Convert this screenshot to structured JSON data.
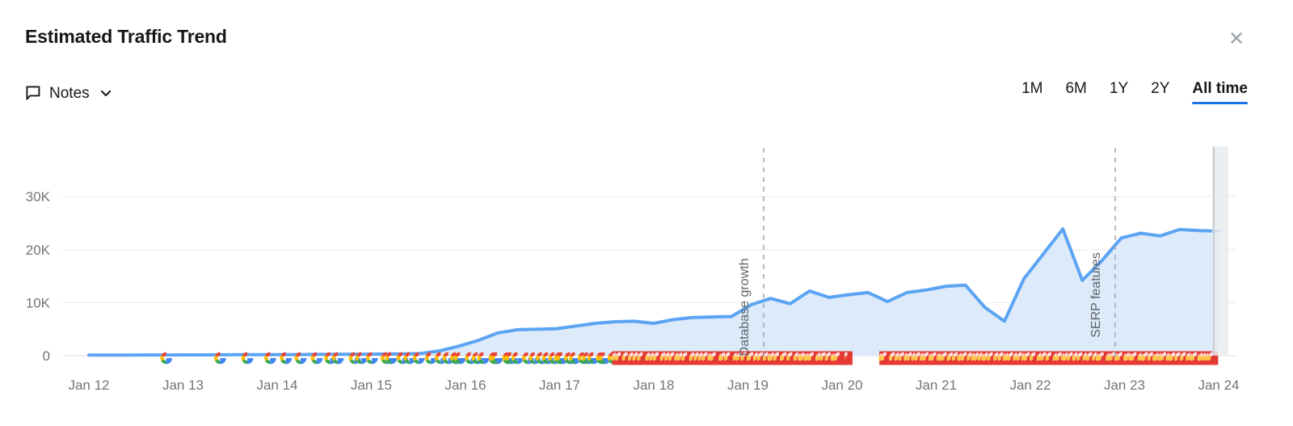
{
  "header": {
    "title": "Estimated Traffic Trend",
    "close_icon": "close-icon",
    "close_label": "×"
  },
  "notes": {
    "label": "Notes",
    "icon": "comment-bubble-icon",
    "caret_icon": "chevron-down-icon",
    "expanded": false
  },
  "range_selector": {
    "options": [
      {
        "label": "1M",
        "active": false
      },
      {
        "label": "6M",
        "active": false
      },
      {
        "label": "1Y",
        "active": false
      },
      {
        "label": "2Y",
        "active": false
      },
      {
        "label": "All time",
        "active": true
      }
    ],
    "selected": "All time",
    "accent_color": "#1a73e8"
  },
  "colors": {
    "line": "#5ba4f3",
    "fill": "#dceafa",
    "grid": "#e8eaed",
    "axis_text": "#70757a",
    "annotation_text": "#5f6368",
    "dashed_line": "#9aa0a6",
    "cursor_band": "#e9ecef",
    "title_text": "#15181b"
  },
  "chart_data": {
    "type": "area",
    "title": "Estimated Traffic Trend",
    "xlabel": "",
    "ylabel": "",
    "grid": true,
    "legend": "none",
    "ylim": [
      0,
      34000
    ],
    "ytick_values": [
      0,
      10000,
      20000,
      30000
    ],
    "ytick_labels": [
      "0",
      "10K",
      "20K",
      "30K"
    ],
    "xtick_labels": [
      "Jan 12",
      "Jan 13",
      "Jan 14",
      "Jan 15",
      "Jan 16",
      "Jan 17",
      "Jan 18",
      "Jan 19",
      "Jan 20",
      "Jan 21",
      "Jan 22",
      "Jan 23",
      "Jan 24"
    ],
    "x": [
      "Jan 12",
      "Jan 12.5",
      "Jan 13",
      "Jan 13.5",
      "Jan 14",
      "Jan 14.5",
      "Jan 15",
      "Jan 15.5",
      "Jan 16",
      "Jan 16.5",
      "Jan 17",
      "Jan 17.5",
      "Jan 18",
      "Jan 18.5",
      "Jan 19",
      "Jan 19.5",
      "Jan 20",
      "Jan 20.3",
      "Jan 20.6",
      "Jan 20.8",
      "Jan 21",
      "Jan 21.1",
      "Jan 21.2",
      "Jan 21.3",
      "Jan 21.4",
      "Jan 21.5",
      "Jan 21.6",
      "Jan 21.7",
      "Jan 21.8",
      "Jan 21.9",
      "Jan 22",
      "Jan 22.1",
      "Jan 22.2",
      "Jan 22.3",
      "Jan 22.4",
      "Jan 22.5",
      "Jan 22.6",
      "Jan 22.7",
      "Jan 22.8",
      "Jan 22.9",
      "Jan 23",
      "Jan 23.1",
      "Jan 23.2",
      "Jan 23.3",
      "Jan 23.4",
      "Jan 23.5",
      "Jan 23.6",
      "Jan 23.7",
      "Jan 23.8",
      "Jan 23.9",
      "Jan 24",
      "Jan 24.1",
      "Jan 24.2",
      "Jan 24.3"
    ],
    "values": [
      100,
      110,
      120,
      130,
      140,
      150,
      160,
      170,
      180,
      190,
      200,
      220,
      240,
      260,
      280,
      300,
      320,
      400,
      900,
      1800,
      2900,
      4300,
      4900,
      5000,
      5100,
      5600,
      6100,
      6400,
      6500,
      6100,
      6800,
      7200,
      7300,
      7400,
      9600,
      10800,
      9800,
      12200,
      11000,
      11500,
      11900,
      10200,
      11900,
      12400,
      13100,
      13300,
      9100,
      6500,
      14500,
      19200,
      23900,
      14200,
      17900,
      22200,
      23100,
      22600,
      23800,
      23600,
      23500
    ],
    "annotations": [
      {
        "label": "Database growth",
        "x_position": "Jan 19.6",
        "orientation": "vertical"
      },
      {
        "label": "SERP features",
        "x_position": "Jan 23.05",
        "orientation": "vertical"
      }
    ],
    "event_markers": {
      "icon": "google-update-icon",
      "description": "Google algorithm update markers along the zero baseline",
      "count_visible": 210
    }
  }
}
